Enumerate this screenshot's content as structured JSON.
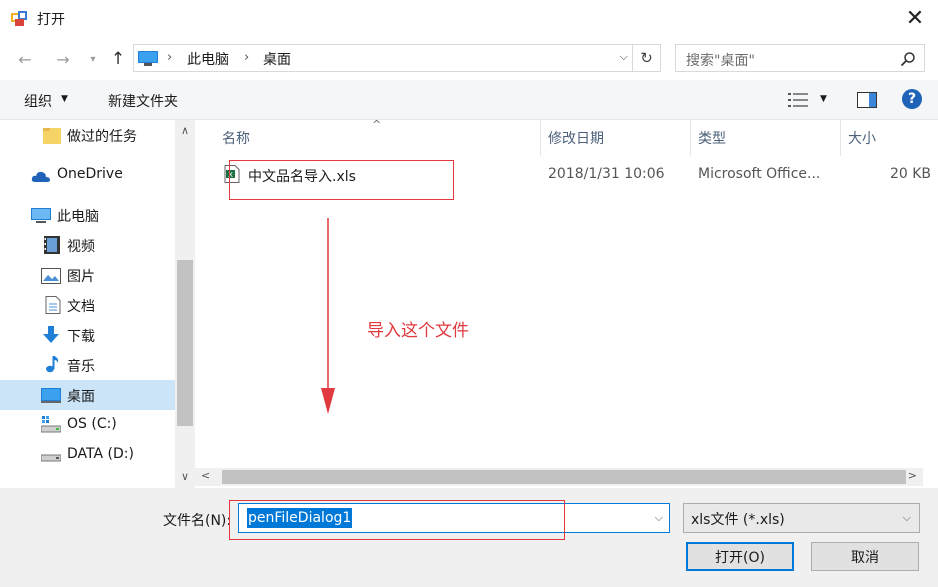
{
  "window": {
    "title": "打开"
  },
  "address": {
    "crumbs": [
      "此电脑",
      "桌面"
    ]
  },
  "search": {
    "placeholder": "搜索\"桌面\""
  },
  "toolbar": {
    "organize": "组织",
    "new_folder": "新建文件夹",
    "help": "?"
  },
  "sidebar": {
    "items": [
      {
        "label": "做过的任务",
        "icon": "folder-icon"
      },
      {
        "label": "OneDrive",
        "icon": "cloud-icon"
      },
      {
        "label": "此电脑",
        "icon": "computer-icon"
      },
      {
        "label": "视频",
        "icon": "video-icon"
      },
      {
        "label": "图片",
        "icon": "picture-icon"
      },
      {
        "label": "文档",
        "icon": "document-icon"
      },
      {
        "label": "下载",
        "icon": "download-icon"
      },
      {
        "label": "音乐",
        "icon": "music-icon"
      },
      {
        "label": "桌面",
        "icon": "desktop-icon",
        "selected": true
      },
      {
        "label": "OS (C:)",
        "icon": "drive-icon"
      },
      {
        "label": "DATA (D:)",
        "icon": "drive-icon"
      }
    ]
  },
  "columns": {
    "name": "名称",
    "modified": "修改日期",
    "type": "类型",
    "size": "大小"
  },
  "files": [
    {
      "name": "中文品名导入.xls",
      "modified": "2018/1/31 10:06",
      "type": "Microsoft Office...",
      "size": "20 KB",
      "icon": "excel-file-icon"
    }
  ],
  "annotation": {
    "text": "导入这个文件",
    "color": "#e0393e"
  },
  "bottom": {
    "filename_label": "文件名(N):",
    "filename_value": "penFileDialog1",
    "filter_value": "xls文件 (*.xls)",
    "open_label": "打开(O)",
    "cancel_label": "取消"
  },
  "colors": {
    "accent": "#0078d7",
    "selected_bg": "#cce4f7",
    "help_blue": "#1f63b8"
  }
}
